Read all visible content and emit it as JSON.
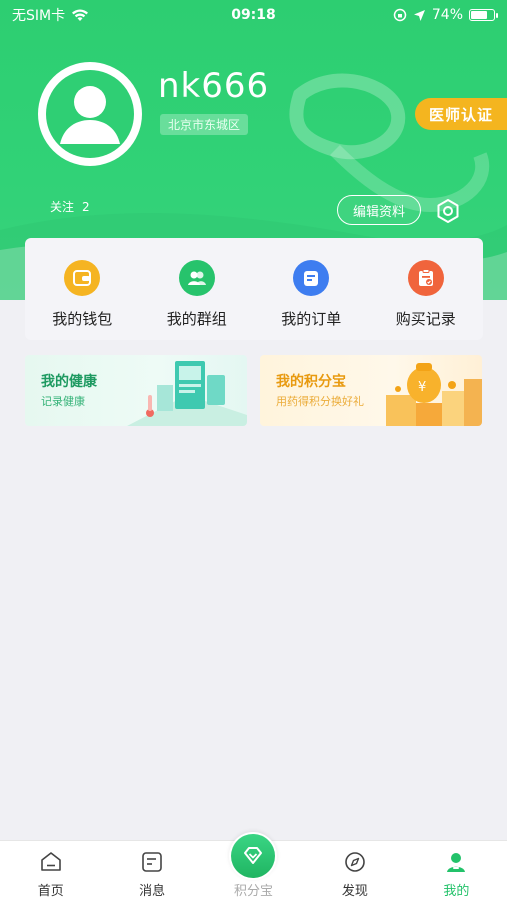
{
  "status_bar": {
    "carrier": "无SIM卡",
    "time": "09:18",
    "battery": "74%",
    "battery_level": 0.74,
    "icons": [
      "wifi-icon",
      "orientation-lock-icon",
      "location-icon",
      "battery-icon"
    ]
  },
  "profile": {
    "username": "nk666",
    "location": "北京市东城区",
    "doctor_badge": "医师认证",
    "follow_label": "关注",
    "follow_count": "2",
    "edit_label": "编辑资料",
    "icons": [
      "avatar-icon",
      "settings-icon"
    ]
  },
  "menu": [
    {
      "label": "我的钱包",
      "icon": "wallet-icon",
      "color": "#f5b422"
    },
    {
      "label": "我的群组",
      "icon": "group-icon",
      "color": "#27c36c"
    },
    {
      "label": "我的订单",
      "icon": "order-icon",
      "color": "#3e7df0"
    },
    {
      "label": "购买记录",
      "icon": "record-icon",
      "color": "#f0643c"
    }
  ],
  "promos": {
    "health": {
      "title": "我的健康",
      "subtitle": "记录健康"
    },
    "points": {
      "title": "我的积分宝",
      "subtitle": "用药得积分换好礼"
    }
  },
  "tabs": [
    {
      "label": "首页",
      "icon": "home-icon"
    },
    {
      "label": "消息",
      "icon": "message-icon"
    },
    {
      "label": "积分宝",
      "icon": "diamond-icon"
    },
    {
      "label": "发现",
      "icon": "compass-icon"
    },
    {
      "label": "我的",
      "icon": "user-icon",
      "active": true
    }
  ],
  "colors": {
    "brand_green": "#2dce71",
    "badge_gold": "#f4b51f",
    "active_tab": "#23c26a"
  }
}
